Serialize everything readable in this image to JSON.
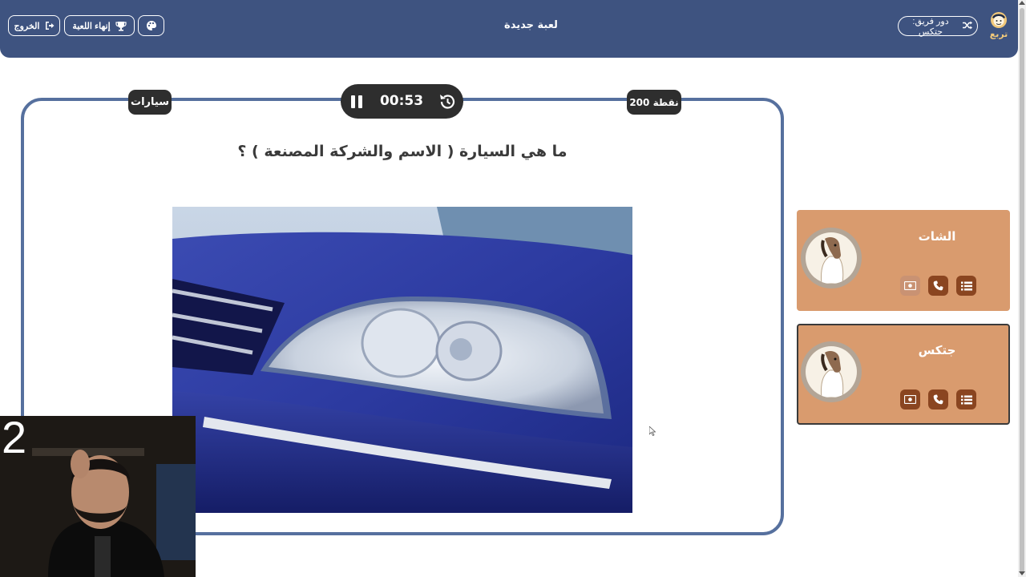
{
  "header": {
    "title": "لعبة جديدة",
    "exit_label": "الخروج",
    "end_game_label": "إنهاء اللعبة",
    "turn_label": "دور فريق: جتكس",
    "logo_text": "تربع",
    "bar_color": "#3e5380"
  },
  "question": {
    "category": "سيارات",
    "points": "200 نقطة",
    "timer": "00:53",
    "text": "ما هي السيارة ( الاسم والشركة المصنعة ) ؟"
  },
  "teams": [
    {
      "name": "الشات",
      "active": false
    },
    {
      "name": "جتكس",
      "active": true
    }
  ],
  "webcam": {
    "overlay_number": "2"
  },
  "icons": {
    "exit": "sign-out-icon",
    "end_game": "trophy-icon",
    "palette": "palette-icon",
    "turn": "shuffle-icon",
    "pause": "pause-icon",
    "reset": "history-icon",
    "list": "list-icon",
    "phone": "phone-icon",
    "money": "money-icon"
  },
  "colors": {
    "card_border": "#56709e",
    "team_bg": "#d99b6e",
    "tool_bg": "#8a4520",
    "pill_bg": "#2e2e2e"
  }
}
